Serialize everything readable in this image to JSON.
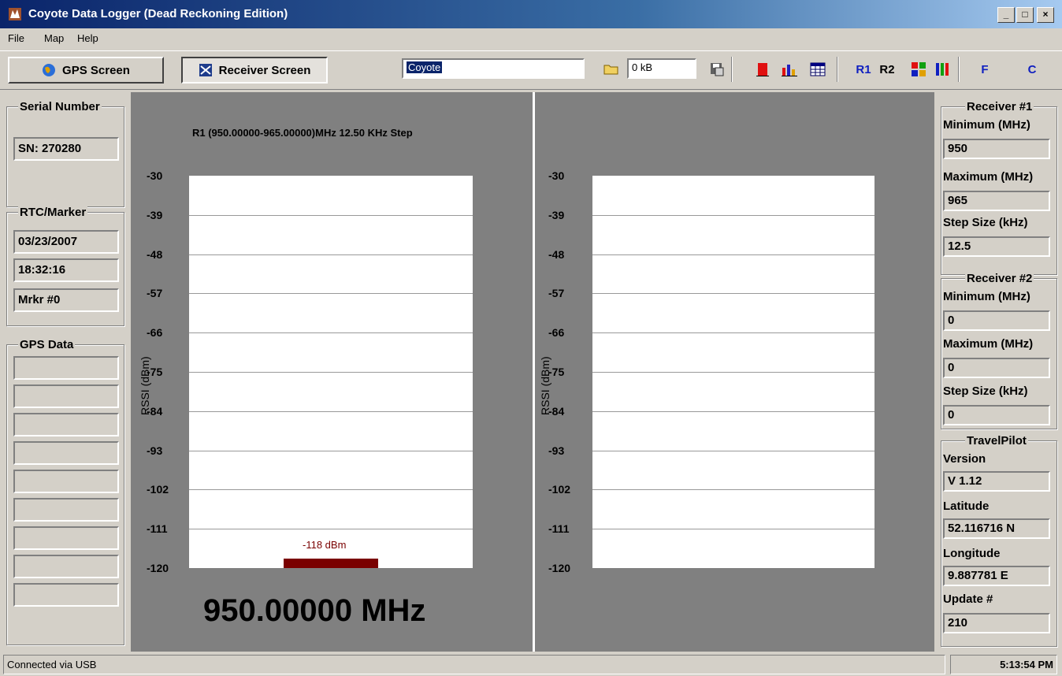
{
  "window": {
    "title": "Coyote Data Logger (Dead Reckoning Edition)",
    "minimize": "_",
    "maximize": "□",
    "close": "×"
  },
  "menu": {
    "file": "File",
    "map": "Map",
    "help": "Help"
  },
  "toolbar": {
    "gps_screen": "GPS Screen",
    "receiver_screen": "Receiver Screen",
    "name_value": "Coyote",
    "size_value": "0 kB",
    "r1": "R1",
    "r2": "R2",
    "f": "F",
    "c": "C"
  },
  "left": {
    "serial_title": "Serial Number",
    "serial": "SN: 270280",
    "rtc_title": "RTC/Marker",
    "date": "03/23/2007",
    "time": "18:32:16",
    "marker": "Mrkr #0",
    "gps_title": "GPS Data",
    "gps_fields": [
      "",
      "",
      "",
      "",
      "",
      "",
      "",
      "",
      ""
    ]
  },
  "chart_data": [
    {
      "type": "bar",
      "title": "R1 (950.00000-965.00000)MHz 12.50 KHz Step",
      "ylabel": "RSSI (dBm)",
      "yticks": [
        "-30",
        "-39",
        "-48",
        "-57",
        "-66",
        "-75",
        "-84",
        "-93",
        "-102",
        "-111",
        "-120"
      ],
      "ylim": [
        -120,
        -30
      ],
      "values": [
        -118
      ],
      "value_label": "-118 dBm",
      "frequency": "950.00000 MHz",
      "bar_color": "#7a0000"
    },
    {
      "type": "bar",
      "title": "",
      "ylabel": "RSSI (dBm)",
      "yticks": [
        "-30",
        "-39",
        "-48",
        "-57",
        "-66",
        "-75",
        "-84",
        "-93",
        "-102",
        "-111",
        "-120"
      ],
      "ylim": [
        -120,
        -30
      ],
      "values": []
    }
  ],
  "right": {
    "r1_title": "Receiver #1",
    "r1_min_label": "Minimum (MHz)",
    "r1_min": "950",
    "r1_max_label": "Maximum (MHz)",
    "r1_max": "965",
    "r1_step_label": "Step Size (kHz)",
    "r1_step": "12.5",
    "r2_title": "Receiver #2",
    "r2_min_label": "Minimum (MHz)",
    "r2_min": "0",
    "r2_max_label": "Maximum (MHz)",
    "r2_max": "0",
    "r2_step_label": "Step Size (kHz)",
    "r2_step": "0",
    "tp_title": "TravelPilot",
    "version_label": "Version",
    "version": "V 1.12",
    "lat_label": "Latitude",
    "lat": "52.116716 N",
    "lon_label": "Longitude",
    "lon": "9.887781 E",
    "update_label": "Update #",
    "update": "210"
  },
  "status": {
    "connection": "Connected via USB",
    "clock": "5:13:54 PM"
  }
}
